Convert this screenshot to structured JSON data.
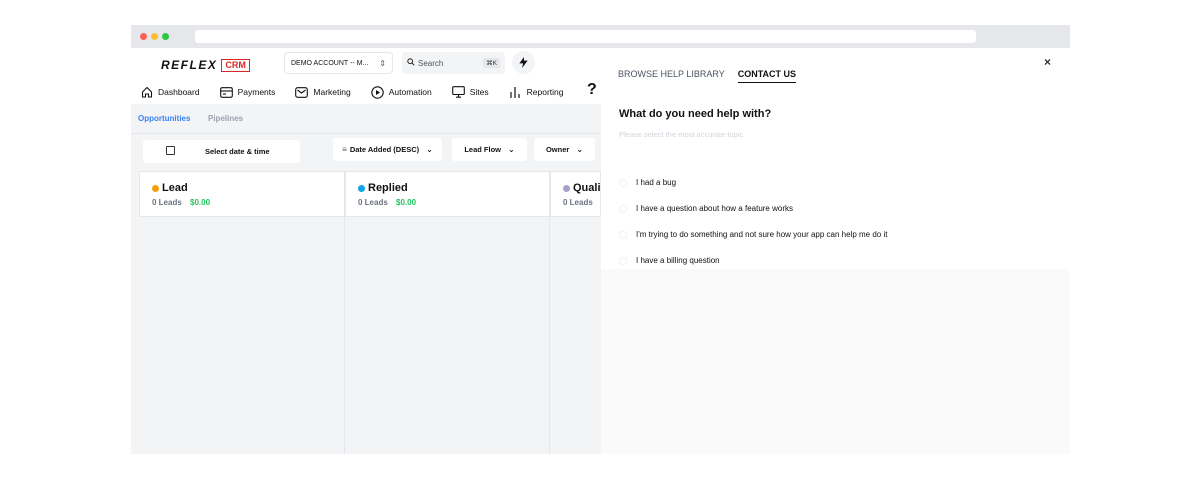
{
  "app": {
    "logo_text": "REFLEX",
    "logo_badge": "CRM",
    "account": "DEMO ACCOUNT -- M...",
    "search_placeholder": "Search",
    "search_shortcut": "⌘K"
  },
  "nav": {
    "items": [
      {
        "label": "Dashboard",
        "icon": "home-icon"
      },
      {
        "label": "Payments",
        "icon": "card-icon"
      },
      {
        "label": "Marketing",
        "icon": "mail-icon"
      },
      {
        "label": "Automation",
        "icon": "play-icon"
      },
      {
        "label": "Sites",
        "icon": "monitor-icon"
      },
      {
        "label": "Reporting",
        "icon": "bar-chart-icon"
      }
    ],
    "help": "?"
  },
  "subtabs": {
    "active": "Opportunities",
    "inactive": "Pipelines"
  },
  "filters": {
    "date": "Select date & time",
    "sort": "Date Added (DESC)",
    "flow": "Lead Flow",
    "owner": "Owner"
  },
  "stages": [
    {
      "name": "Lead",
      "leads": "0 Leads",
      "amount": "$0.00",
      "color": "#f59e0b"
    },
    {
      "name": "Replied",
      "leads": "0 Leads",
      "amount": "$0.00",
      "color": "#0ea5e9"
    },
    {
      "name": "Qualified",
      "leads": "0 Leads",
      "amount": "",
      "color": "#a5a3c9"
    }
  ],
  "help": {
    "tab_library": "BROWSE HELP LIBRARY",
    "tab_contact": "CONTACT US",
    "close": "×",
    "question": "What do you need help with?",
    "subtitle": "Please select the most accurate topic",
    "options": [
      "I had a bug",
      "I have a question about how a feature works",
      "I'm trying to do something and not sure how your app can help me do it",
      "I have a billing question"
    ]
  }
}
